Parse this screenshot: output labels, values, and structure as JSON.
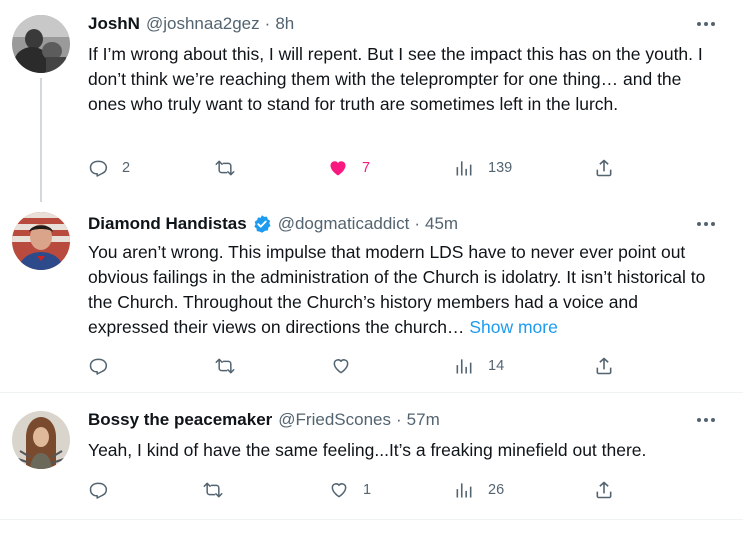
{
  "tweets": [
    {
      "name": "JoshN",
      "handle": "@joshnaa2gez",
      "time": "8h",
      "text": "If I’m wrong about this, I will repent. But I see the impact this has on the youth. I don’t think we’re reaching them with the teleprompter for one thing… and the ones who truly want to stand for truth are sometimes left in the lurch.",
      "replies": "2",
      "retweets": "",
      "likes": "7",
      "views": "139"
    },
    {
      "name": "Diamond Handistas",
      "handle": "@dogmaticaddict",
      "time": "45m",
      "text": "You aren’t wrong. This impulse that modern LDS have to never ever point out obvious failings in the administration of the Church is idolatry. It isn’t historical to the Church. Throughout the Church’s history members had a voice and expressed their views on directions the church…",
      "show_more": "Show more",
      "replies": "",
      "retweets": "",
      "likes": "",
      "views": "14"
    },
    {
      "name": "Bossy the peacemaker",
      "handle": "@FriedScones",
      "time": "57m",
      "text": "Yeah, I kind of have the same feeling...It’s a freaking minefield out there.",
      "replies": "",
      "retweets": "",
      "likes": "1",
      "views": "26"
    }
  ],
  "separator": "·",
  "icons": {
    "reply": "reply-icon",
    "retweet": "retweet-icon",
    "like": "heart-icon",
    "liked": "heart-filled-icon",
    "views": "views-chart-icon",
    "share": "share-icon",
    "more": "more-horizontal-icon",
    "verified": "verified-badge-icon"
  },
  "colors": {
    "like_active": "#f91880",
    "link": "#1d9bf0",
    "verified": "#1d9bf0",
    "muted": "#536471"
  }
}
